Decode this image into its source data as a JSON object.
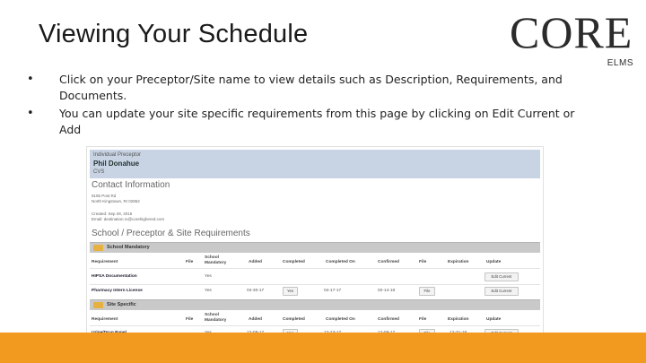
{
  "slide": {
    "title": "Viewing Your Schedule",
    "logo": {
      "main": "CORE",
      "sub": "ELMS"
    },
    "bullets": [
      "Click on your Preceptor/Site name to view details such as Description, Requirements, and Documents.",
      "You can update your site specific requirements from this page by clicking on Edit Current or Add"
    ],
    "bullet_marker": "•",
    "footer_color": "#f29a1f"
  },
  "screenshot": {
    "header": {
      "type_label": "Individual Preceptor",
      "name": "Phil Donahue",
      "site": "CVS"
    },
    "contact": {
      "heading": "Contact Information",
      "lines": [
        "9195 Post Rd",
        "North Kingstown, RI 02852",
        "Created: Sep 29, 2016",
        "Email: destination.rx@corehighered.com"
      ]
    },
    "requirements_heading": "School / Preceptor & Site Requirements",
    "columns": [
      "Requirement",
      "File",
      "School Mandatory",
      "Added",
      "Completed",
      "Completed On",
      "Confirmed",
      "File",
      "Expiration",
      "Update"
    ],
    "groups": [
      {
        "label": "School Mandatory",
        "rows": [
          {
            "requirement": "HIPSA Documentation",
            "file": "",
            "mandatory": "Yes",
            "added": "",
            "completed": "",
            "completed_on": "",
            "confirmed": "",
            "file2": "",
            "expiration": "",
            "update": "Edit Current"
          },
          {
            "requirement": "Pharmacy Intern License",
            "file": "",
            "mandatory": "Yes",
            "added": "04-30-17",
            "completed": "Yes",
            "completed_on": "04-17-17",
            "confirmed": "02-14-18",
            "file2": "File",
            "expiration": "",
            "update": "Edit Current"
          }
        ]
      },
      {
        "label": "Site Specific",
        "rows": [
          {
            "requirement": "Urine/Drug Panel",
            "file": "",
            "mandatory": "Yes",
            "added": "12-08-17",
            "completed": "Yes",
            "completed_on": "12-23-17",
            "confirmed": "12-08-17",
            "file2": "File",
            "expiration": "12-31-18",
            "update": "Edit Current"
          }
        ]
      }
    ]
  }
}
